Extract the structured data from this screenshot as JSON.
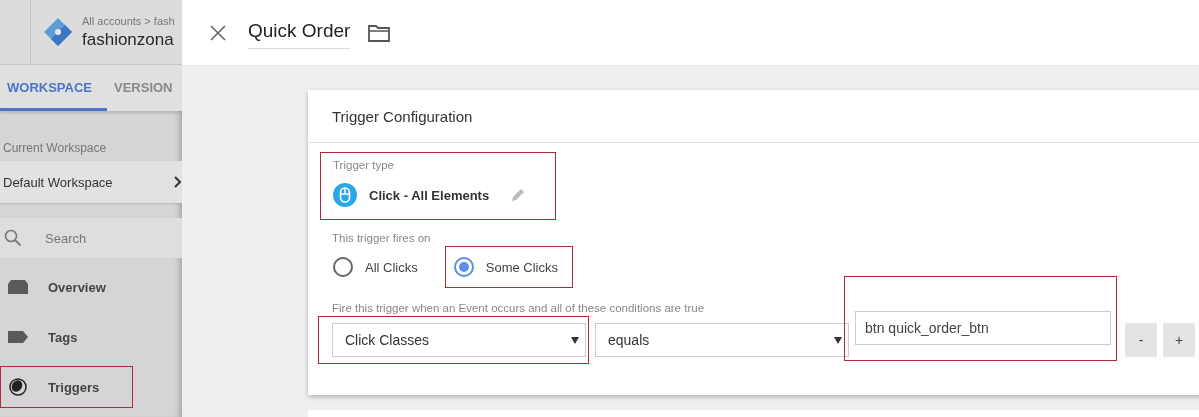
{
  "sidebar": {
    "breadcrumb": "All accounts > fash",
    "account": "fashionzona",
    "tabs": [
      {
        "label": "WORKSPACE",
        "selected": true
      },
      {
        "label": "VERSION",
        "selected": false
      }
    ],
    "workspace_label": "Current Workspace",
    "workspace": "Default Workspace",
    "search": {
      "placeholder": "Search"
    },
    "nav": [
      {
        "label": "Overview",
        "kind": "overview",
        "highlighted": false
      },
      {
        "label": "Tags",
        "kind": "tags",
        "highlighted": false
      },
      {
        "label": "Triggers",
        "kind": "triggers",
        "highlighted": true
      }
    ]
  },
  "panel": {
    "title": "Quick Order",
    "card": {
      "title": "Trigger Configuration",
      "trigger_type": {
        "label": "Trigger type",
        "value": "Click - All Elements",
        "highlighted": true
      },
      "fires_on": {
        "label": "This trigger fires on",
        "options": [
          {
            "label": "All Clicks",
            "selected": false,
            "highlighted": false
          },
          {
            "label": "Some Clicks",
            "selected": true,
            "highlighted": true
          }
        ]
      },
      "conditions": {
        "label": "Fire this trigger when an Event occurs and all of these conditions are true",
        "rows": [
          {
            "variable": "Click Classes",
            "variable_highlighted": true,
            "operator": "equals",
            "operator_highlighted": false,
            "value": "btn quick_order_btn",
            "value_highlighted": true
          }
        ],
        "buttons": [
          "-",
          "+"
        ]
      }
    }
  }
}
